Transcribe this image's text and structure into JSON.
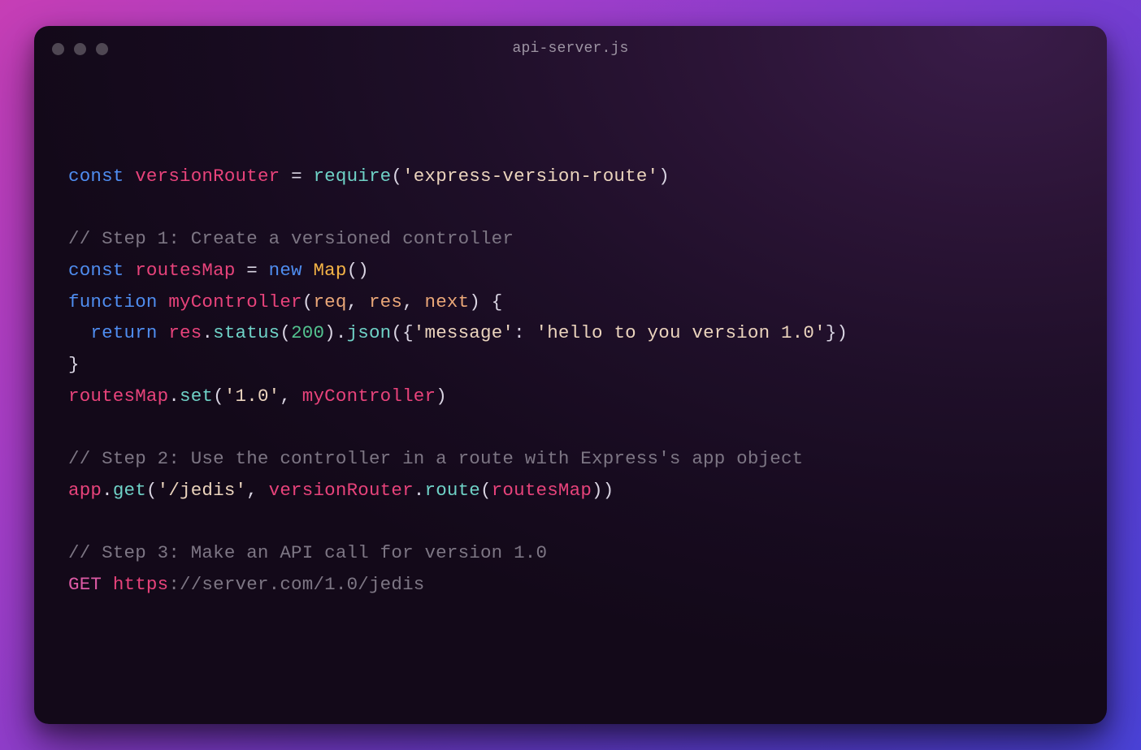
{
  "window": {
    "title": "api-server.js"
  },
  "code": {
    "l1": {
      "kw_const": "const",
      "ident": "versionRouter",
      "eq": "=",
      "fn_require": "require",
      "lp": "(",
      "str": "'express-version-route'",
      "rp": ")"
    },
    "l3": {
      "cmt": "// Step 1: Create a versioned controller"
    },
    "l4": {
      "kw_const": "const",
      "ident": "routesMap",
      "eq": "=",
      "kw_new": "new",
      "type": "Map",
      "parens": "()"
    },
    "l5": {
      "kw_function": "function",
      "ident": "myController",
      "lp": "(",
      "p1": "req",
      "c1": ", ",
      "p2": "res",
      "c2": ", ",
      "p3": "next",
      "rp": ")",
      "brace": " {"
    },
    "l6": {
      "indent": "  ",
      "kw_return": "return",
      "ident_res": "res",
      "dot1": ".",
      "fn_status": "status",
      "lp1": "(",
      "num": "200",
      "rp1": ")",
      "dot2": ".",
      "fn_json": "json",
      "lp2": "({",
      "key": "'message'",
      "colon": ": ",
      "val": "'hello to you version 1.0'",
      "rp2": "})"
    },
    "l7": {
      "brace": "}"
    },
    "l8": {
      "ident": "routesMap",
      "dot": ".",
      "fn_set": "set",
      "lp": "(",
      "str": "'1.0'",
      "comma": ", ",
      "ident2": "myController",
      "rp": ")"
    },
    "l10": {
      "cmt": "// Step 2: Use the controller in a route with Express's app object"
    },
    "l11": {
      "ident_app": "app",
      "dot1": ".",
      "fn_get": "get",
      "lp": "(",
      "str": "'/jedis'",
      "comma": ", ",
      "ident_vr": "versionRouter",
      "dot2": ".",
      "fn_route": "route",
      "lp2": "(",
      "ident_rm": "routesMap",
      "rp2": ")",
      "rp": ")"
    },
    "l13": {
      "cmt": "// Step 3: Make an API call for version 1.0"
    },
    "l14": {
      "verb": "GET ",
      "ident_https": "https",
      "rest": "://server.com/1.0/jedis"
    }
  }
}
